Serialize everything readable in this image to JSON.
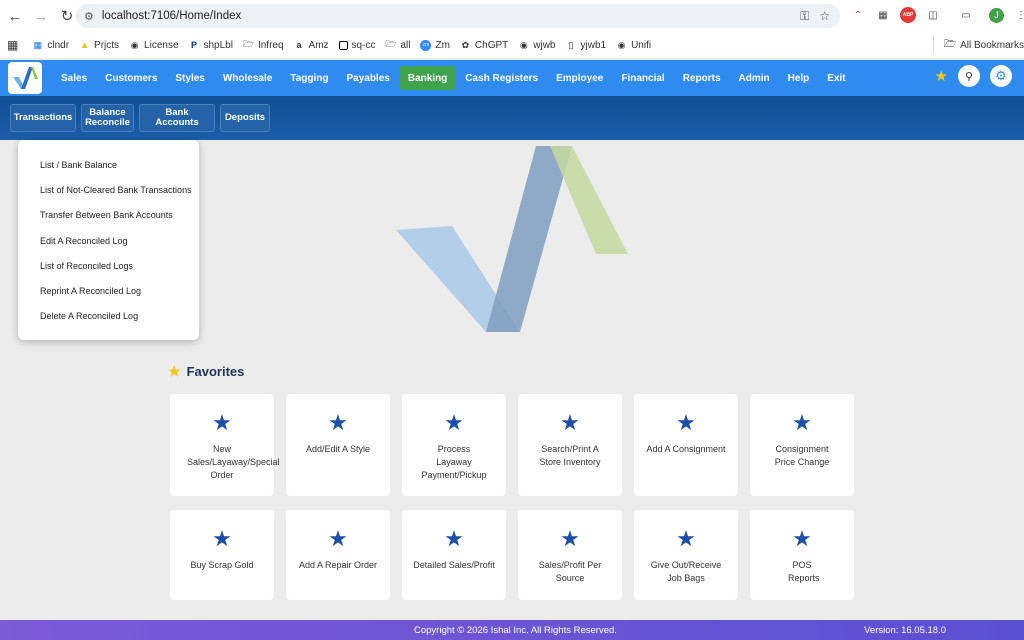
{
  "browser": {
    "url": "localhost:7106/Home/Index",
    "bookmarks": [
      "clndr",
      "Prjcts",
      "License",
      "shpLbl",
      "Infreq",
      "Amz",
      "sq-cc",
      "all",
      "Zm",
      "ChGPT",
      "wjwb",
      "yjwb1",
      "Unifi"
    ],
    "all_bookmarks": "All Bookmarks",
    "profile_initial": "J"
  },
  "nav": {
    "items": [
      "Sales",
      "Customers",
      "Styles",
      "Wholesale",
      "Tagging",
      "Payables",
      "Banking",
      "Cash Registers",
      "Employee",
      "Financial",
      "Reports",
      "Admin",
      "Help",
      "Exit"
    ],
    "active": "Banking",
    "active_color": "#3fa34d",
    "bar_color": "#2f8bf0"
  },
  "subnav": {
    "transactions": "Transactions",
    "balance_reconcile_1": "Balance",
    "balance_reconcile_2": "Reconcile",
    "bank_accounts": "Bank Accounts",
    "deposits": "Deposits"
  },
  "dropdown": {
    "items": [
      "List / Bank Balance",
      "List of Not-Cleared Bank Transactions",
      "Transfer Between Bank Accounts",
      "Edit A Reconciled Log",
      "List of Reconciled Logs",
      "Reprint A Reconciled Log",
      "Delete A Reconciled Log"
    ]
  },
  "favorites": {
    "title": "Favorites",
    "cards": [
      {
        "label": "New Sales/Layaway/Special Order"
      },
      {
        "label": "Add/Edit A Style"
      },
      {
        "label": "Process Layaway Payment/Pickup"
      },
      {
        "label": "Search/Print A Store Inventory"
      },
      {
        "label": "Add A Consignment"
      },
      {
        "label": "Consignment Price Change"
      },
      {
        "label": "Buy Scrap Gold"
      },
      {
        "label": "Add A Repair Order"
      },
      {
        "label": "Detailed Sales/Profit"
      },
      {
        "label": "Sales/Profit Per Source"
      },
      {
        "label": "Give Out/Receive Job Bags"
      },
      {
        "label": "POS Reports"
      }
    ]
  },
  "footer": {
    "copyright": "Copyright © 2026 Ishal Inc. All Rights Reserved.",
    "version": "Version: 16.05.18.0"
  }
}
